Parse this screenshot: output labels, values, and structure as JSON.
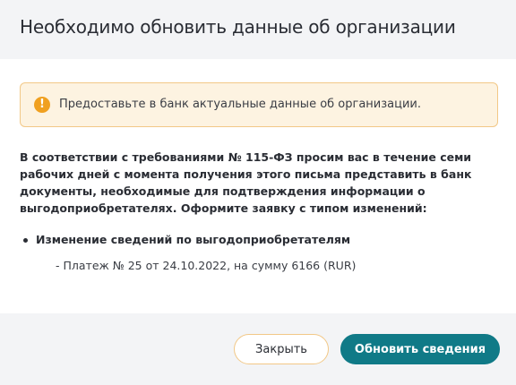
{
  "dialog": {
    "title": "Необходимо обновить данные об организации"
  },
  "alert": {
    "icon": "warning-icon",
    "icon_glyph": "!",
    "color": "#f0a020",
    "text": "Предоставьте в банк актуальные данные об организации."
  },
  "body": {
    "paragraph": "В соответствии с требованиями № 115-ФЗ просим вас в течение семи рабочих дней с момента получения этого письма представить в банк документы, необходимые для подтверждения информации о выгодоприобретателях. Оформите заявку с типом изменений:",
    "list": [
      {
        "label": "Изменение сведений по выгодоприобретателям",
        "detail": "- Платеж № 25 от 24.10.2022, на сумму 6166 (RUR)"
      }
    ]
  },
  "footer": {
    "close_label": "Закрыть",
    "update_label": "Обновить сведения",
    "primary_color": "#107a87"
  }
}
